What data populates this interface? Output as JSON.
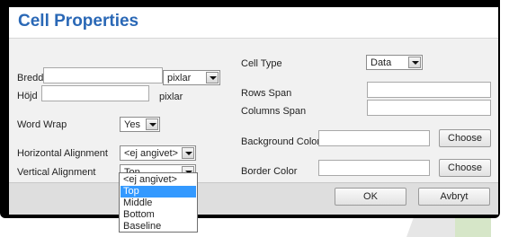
{
  "dialog": {
    "title": "Cell Properties"
  },
  "left": {
    "width_label": "Bredd",
    "width_value": "",
    "width_unit": "pixlar",
    "height_label": "Höjd",
    "height_value": "",
    "height_unit_text": "pixlar",
    "wordwrap_label": "Word Wrap",
    "wordwrap_value": "Yes",
    "halign_label": "Horizontal Alignment",
    "halign_value": "<ej angivet>",
    "valign_label": "Vertical Alignment",
    "valign_value": "Top"
  },
  "right": {
    "celltype_label": "Cell Type",
    "celltype_value": "Data",
    "rowsspan_label": "Rows Span",
    "rowsspan_value": "",
    "colsspan_label": "Columns Span",
    "colsspan_value": "",
    "bgcolor_label": "Background Color",
    "bgcolor_value": "",
    "bordercolor_label": "Border Color",
    "bordercolor_value": "",
    "choose_label": "Choose"
  },
  "dropdown": {
    "options": [
      "<ej angivet>",
      "Top",
      "Middle",
      "Bottom",
      "Baseline"
    ],
    "selected": "Top"
  },
  "footer": {
    "ok_label": "OK",
    "cancel_label": "Avbryt"
  },
  "colors": {
    "title": "#2a68b6",
    "selection": "#3399ff",
    "frame": "#000000"
  }
}
